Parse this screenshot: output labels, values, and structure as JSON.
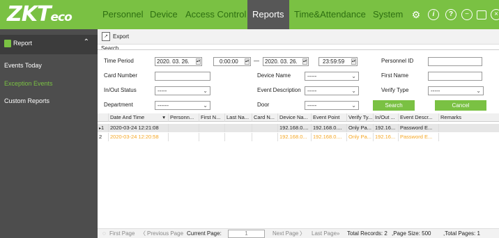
{
  "app": {
    "logo_main": "ZKT",
    "logo_sub": "eco",
    "brand_color": "#7ac143"
  },
  "nav": {
    "items": [
      {
        "label": "Personnel",
        "active": false
      },
      {
        "label": "Device",
        "active": false
      },
      {
        "label": "Access Control",
        "active": false
      },
      {
        "label": "Reports",
        "active": true
      },
      {
        "label": "Time&Attendance",
        "active": false
      },
      {
        "label": "System",
        "active": false
      }
    ],
    "icons": [
      "settings-icon",
      "info-icon",
      "help-icon",
      "minimize-icon",
      "window-icon",
      "close-icon"
    ]
  },
  "sidebar": {
    "header": "Report",
    "items": [
      {
        "label": "Events Today",
        "active": false
      },
      {
        "label": "Exception Events",
        "active": true
      },
      {
        "label": "Custom Reports",
        "active": false
      }
    ]
  },
  "toolbar": {
    "export_label": "Export"
  },
  "search": {
    "legend": "Search",
    "time_period_label": "Time Period",
    "start_date": "2020. 03. 26.",
    "start_time": "0:00:00",
    "separator": "—",
    "end_date": "2020. 03. 26.",
    "end_time": "23:59:59",
    "personnel_id_label": "Personnel ID",
    "personnel_id_value": "",
    "card_number_label": "Card Number",
    "card_number_value": "",
    "device_name_label": "Device Name",
    "device_name_value": "-----",
    "first_name_label": "First Name",
    "first_name_value": "",
    "inout_status_label": "In/Out Status",
    "inout_status_value": "-----",
    "event_description_label": "Event Description",
    "event_description_value": "-----",
    "verify_type_label": "Verify Type",
    "verify_type_value": "-----",
    "department_label": "Department",
    "department_value": "------",
    "door_label": "Door",
    "door_value": "-----",
    "search_button": "Search",
    "cancel_button": "Cancel"
  },
  "grid": {
    "columns": [
      "Date And Time",
      "Personn...",
      "First N...",
      "Last Na...",
      "Card N...",
      "Device Na...",
      "Event Point",
      "Verify Ty...",
      "In/Out ...",
      "Event Descr...",
      "Remarks"
    ],
    "rows": [
      {
        "num": "1",
        "cells": [
          "2020-03-24 12:21:08",
          "",
          "",
          "",
          "",
          "192.168.0....",
          "192.168.0....",
          "Only Pa...",
          "192.16...",
          "Password E...",
          ""
        ]
      },
      {
        "num": "2",
        "cells": [
          "2020-03-24 12:20:58",
          "",
          "",
          "",
          "",
          "192.168.0...",
          "192.168.0....",
          "Only Pa...",
          "192.16...",
          "Password E...",
          ""
        ]
      }
    ]
  },
  "pager": {
    "first": "First Page",
    "prev": "Previous Page",
    "current_label": "Current Page:",
    "current_value": "1",
    "next": "Next Page",
    "last": "Last Page",
    "total_records": "Total Records:  2",
    "page_size": ",Page Size:  500",
    "total_pages": ",Total Pages:  1"
  }
}
